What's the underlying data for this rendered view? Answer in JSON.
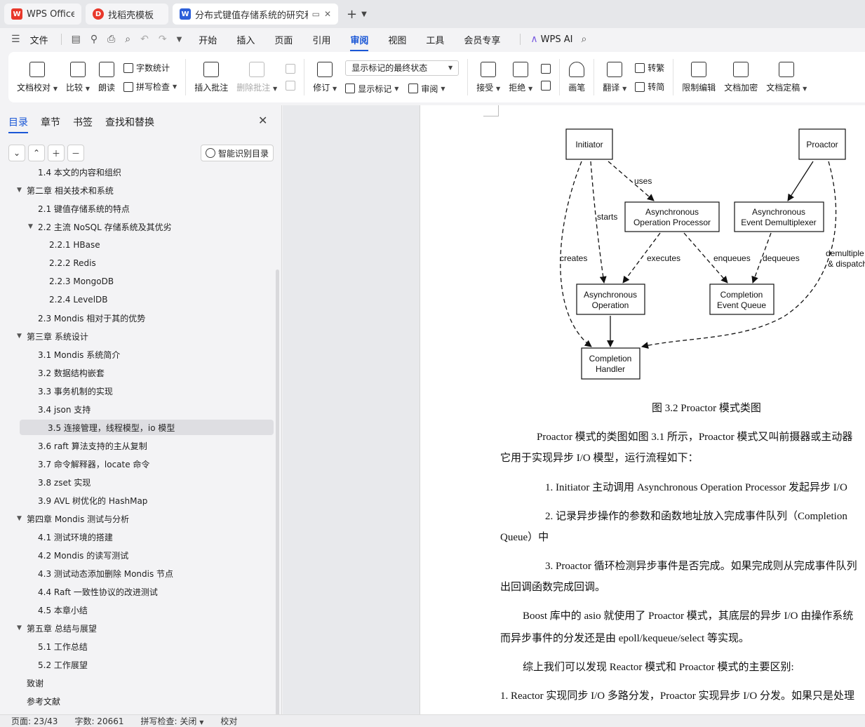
{
  "tabs": [
    {
      "label": "WPS Office"
    },
    {
      "label": "找稻壳模板"
    },
    {
      "label": "分布式键值存储系统的研究和实现"
    }
  ],
  "tabs_extra": {
    "new_tab": "+",
    "more": "⌄"
  },
  "menubar": {
    "file": "文件",
    "items": [
      "开始",
      "插入",
      "页面",
      "引用",
      "审阅",
      "视图",
      "工具",
      "会员专享"
    ],
    "active": "审阅",
    "ai": "WPS AI"
  },
  "ribbon": {
    "doc_check": "文档校对",
    "compare": "比较",
    "read_aloud": "朗读",
    "word_count": "字数统计",
    "spell_check": "拼写检查",
    "insert_comment": "插入批注",
    "delete_comment": "删除批注",
    "track_changes": "修订",
    "markup_state": "显示标记的最终状态",
    "show_markup": "显示标记",
    "review": "审阅",
    "accept": "接受",
    "reject": "拒绝",
    "pen": "画笔",
    "translate": "翻译",
    "to_traditional": "转繁",
    "to_simplified": "转简",
    "restrict_edit": "限制编辑",
    "encrypt": "文档加密",
    "finalize": "文档定稿"
  },
  "nav": {
    "tabs": [
      "目录",
      "章节",
      "书签",
      "查找和替换"
    ],
    "active": "目录",
    "smart_btn": "智能识别目录"
  },
  "toc": [
    {
      "text": "1.4  本文的内容和组织",
      "level": 2
    },
    {
      "text": "第二章  相关技术和系统",
      "level": 1,
      "expanded": true
    },
    {
      "text": "2.1  键值存储系统的特点",
      "level": 2
    },
    {
      "text": "2.2  主流 NoSQL 存储系统及其优劣",
      "level": 2,
      "expanded": true
    },
    {
      "text": "2.2.1 HBase",
      "level": 3
    },
    {
      "text": "2.2.2 Redis",
      "level": 3
    },
    {
      "text": "2.2.3 MongoDB",
      "level": 3
    },
    {
      "text": "2.2.4 LevelDB",
      "level": 3
    },
    {
      "text": "2.3 Mondis 相对于其的优势",
      "level": 2
    },
    {
      "text": "第三章  系统设计",
      "level": 1,
      "expanded": true
    },
    {
      "text": "3.1 Mondis 系统简介",
      "level": 2
    },
    {
      "text": "3.2  数据结构嵌套",
      "level": 2
    },
    {
      "text": "3.3  事务机制的实现",
      "level": 2
    },
    {
      "text": "3.4 json 支持",
      "level": 2
    },
    {
      "text": "3.5  连接管理，线程模型，io 模型",
      "level": 2,
      "selected": true
    },
    {
      "text": "3.6 raft 算法支持的主从复制",
      "level": 2
    },
    {
      "text": "3.7  命令解释器，locate 命令",
      "level": 2
    },
    {
      "text": "3.8 zset 实现",
      "level": 2
    },
    {
      "text": "3.9 AVL 树优化的 HashMap",
      "level": 2
    },
    {
      "text": "第四章  Mondis 测试与分析",
      "level": 1,
      "expanded": true
    },
    {
      "text": "4.1  测试环境的搭建",
      "level": 2
    },
    {
      "text": "4.2 Mondis 的读写测试",
      "level": 2
    },
    {
      "text": "4.3  测试动态添加删除 Mondis 节点",
      "level": 2
    },
    {
      "text": "4.4 Raft 一致性协议的改进测试",
      "level": 2
    },
    {
      "text": "4.5  本章小结",
      "level": 2
    },
    {
      "text": "第五章  总结与展望",
      "level": 1,
      "expanded": true
    },
    {
      "text": "5.1  工作总结",
      "level": 2
    },
    {
      "text": "5.2  工作展望",
      "level": 2
    },
    {
      "text": "致谢",
      "level": 1
    },
    {
      "text": "参考文献",
      "level": 1
    }
  ],
  "diagram": {
    "nodes": {
      "initiator": "Initiator",
      "proactor": "Proactor",
      "aop1": "Asynchronous",
      "aop2": "Operation Processor",
      "aed1": "Asynchronous",
      "aed2": "Event Demultiplexer",
      "ao1": "Asynchronous",
      "ao2": "Operation",
      "ceq1": "Completion",
      "ceq2": "Event Queue",
      "ch1": "Completion",
      "ch2": "Handler"
    },
    "edges": {
      "uses": "uses",
      "starts": "starts",
      "creates": "creates",
      "executes": "executes",
      "enqueues": "enqueues",
      "dequeues": "dequeues",
      "demux1": "demultiple",
      "demux2": "& dispatch"
    }
  },
  "document": {
    "caption": "图 3.2 Proactor 模式类图",
    "p1a": "Proactor 模式的类图如图 3.1 所示，Proactor 模式又叫前摄器或主动器",
    "p1b": "它用于实现异步 I/O 模型，运行流程如下：",
    "l1": "1. Initiator 主动调用 Asynchronous Operation Processor 发起异步 I/O",
    "l2a": "2. 记录异步操作的参数和函数地址放入完成事件队列（Completion",
    "l2b": "Queue）中",
    "l3a": "3. Proactor 循环检测异步事件是否完成。如果完成则从完成事件队列",
    "l3b": "出回调函数完成回调。",
    "p2a": "Boost 库中的 asio 就使用了 Proactor 模式，其底层的异步 I/O 由操作系统",
    "p2b": "而异步事件的分发还是由 epoll/kequeue/select 等实现。",
    "p3": "综上我们可以发现 Reactor 模式和 Proactor 模式的主要区别:",
    "p4": "1. Reactor 实现同步 I/O 多路分发，Proactor 实现异步 I/O 分发。如果只是处理"
  },
  "status": {
    "page": "页面: 23/43",
    "words": "字数: 20661",
    "spell": "拼写检查: 关闭",
    "proof": "校对"
  }
}
